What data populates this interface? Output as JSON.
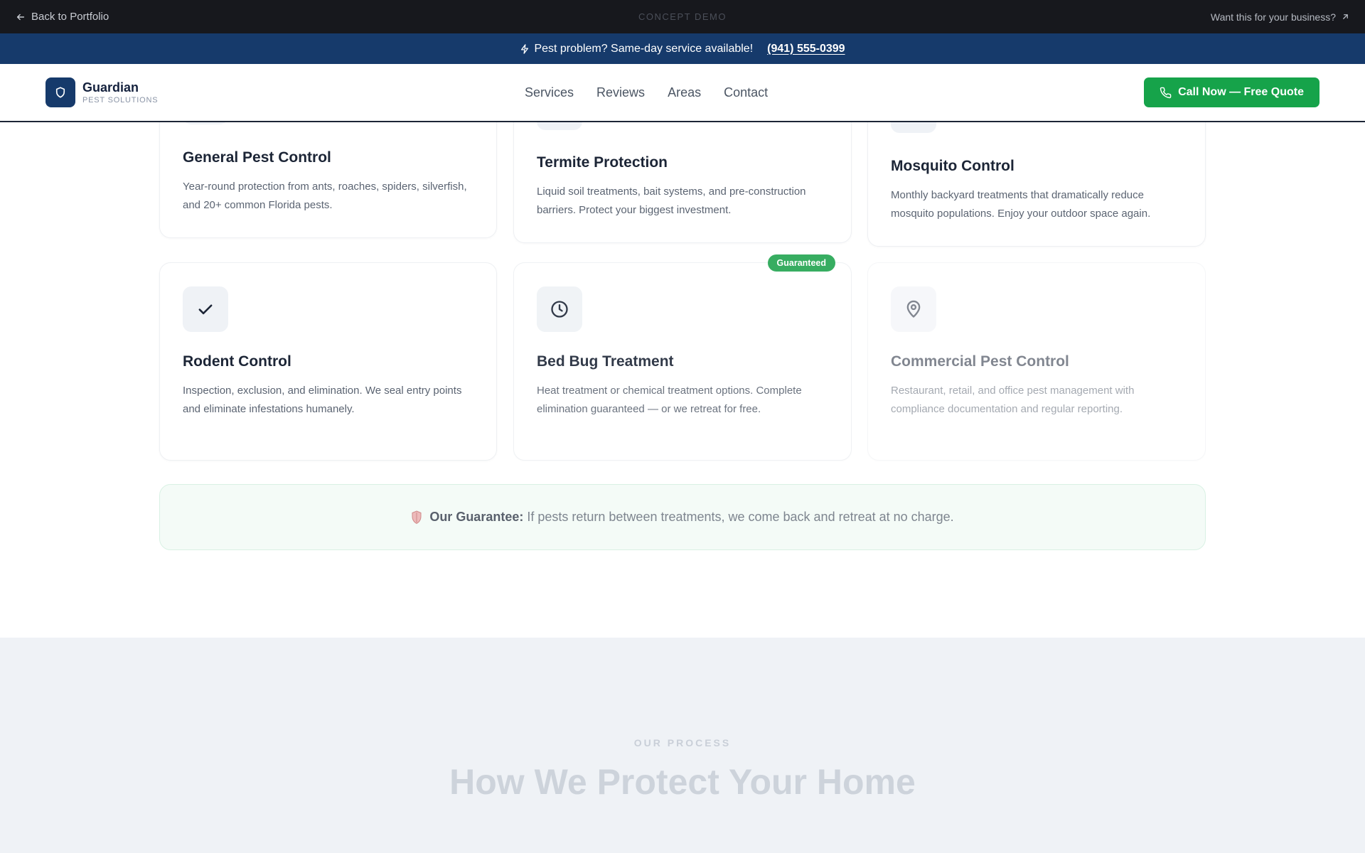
{
  "demo_bar": {
    "back_label": "Back to Portfolio",
    "center_label": "CONCEPT DEMO",
    "cta_label": "Want this for your business?"
  },
  "alert": {
    "text": "Pest problem? Same-day service available!",
    "phone": "(941) 555-0399"
  },
  "brand": {
    "name": "Guardian",
    "tagline": "PEST SOLUTIONS"
  },
  "nav": {
    "links": [
      "Services",
      "Reviews",
      "Areas",
      "Contact"
    ],
    "cta_label": "Call Now — Free Quote"
  },
  "services": [
    {
      "title": "General Pest Control",
      "description": "Year-round protection from ants, roaches, spiders, silverfish, and 20+ common Florida pests."
    },
    {
      "title": "Termite Protection",
      "description": "Liquid soil treatments, bait systems, and pre-construction barriers. Protect your biggest investment."
    },
    {
      "title": "Mosquito Control",
      "description": "Monthly backyard treatments that dramatically reduce mosquito populations. Enjoy your outdoor space again."
    },
    {
      "title": "Rodent Control",
      "description": "Inspection, exclusion, and elimination. We seal entry points and eliminate infestations humanely.",
      "icon": "check-icon"
    },
    {
      "title": "Bed Bug Treatment",
      "description": "Heat treatment or chemical treatment options. Complete elimination guaranteed — or we retreat for free.",
      "icon": "clock-icon",
      "badge": "Guaranteed"
    },
    {
      "title": "Commercial Pest Control",
      "description": "Restaurant, retail, and office pest management with compliance documentation and regular reporting.",
      "icon": "map-pin-icon"
    }
  ],
  "guarantee": {
    "label": "Our Guarantee:",
    "text": "If pests return between treatments, we come back and retreat at no charge."
  },
  "process": {
    "eyebrow": "OUR PROCESS",
    "title": "How We Protect Your Home"
  },
  "colors": {
    "navy": "#163a6b",
    "green": "#16a34a",
    "demo_bar": "#17181d"
  }
}
